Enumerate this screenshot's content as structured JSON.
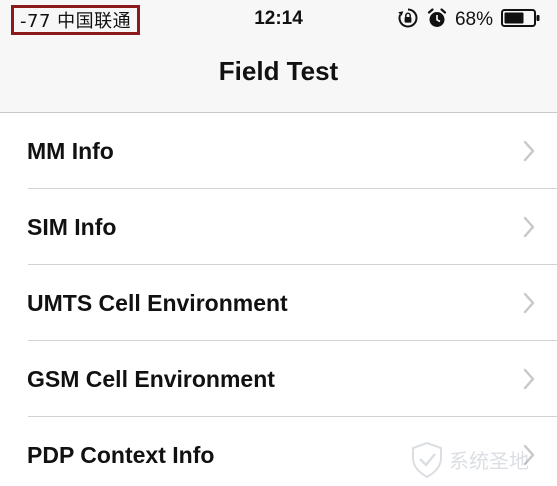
{
  "status_bar": {
    "carrier": "-77 中国联通",
    "time": "12:14",
    "battery_percent": "68%",
    "battery_level": 0.68,
    "icons": [
      "rotation-lock-icon",
      "alarm-icon",
      "battery-icon"
    ],
    "highlight_color": "#8b1a1a"
  },
  "nav": {
    "title": "Field Test"
  },
  "list": {
    "items": [
      {
        "label": "MM Info"
      },
      {
        "label": "SIM Info"
      },
      {
        "label": "UMTS Cell Environment"
      },
      {
        "label": "GSM Cell Environment"
      },
      {
        "label": "PDP Context Info"
      }
    ],
    "chevron_color": "#c7c7cc",
    "separator_color": "#d2d2d2"
  },
  "watermark": {
    "text": "系统圣地"
  }
}
